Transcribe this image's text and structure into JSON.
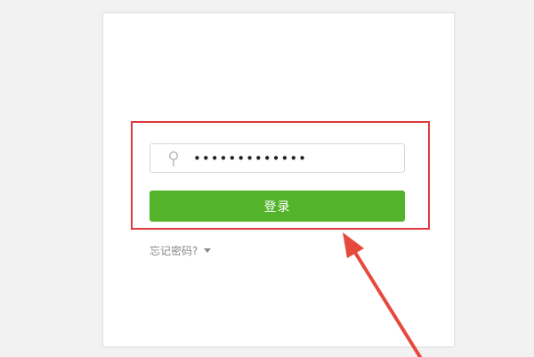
{
  "login": {
    "password_value": "•••••••••••••",
    "submit_label": "登录",
    "forgot_label": "忘记密码?"
  },
  "colors": {
    "button_green": "#53b32a",
    "highlight_red": "#e0393c",
    "arrow_red": "#e64a3c"
  },
  "icons": {
    "password_field": "key-icon",
    "forgot_menu": "caret-down-icon"
  }
}
